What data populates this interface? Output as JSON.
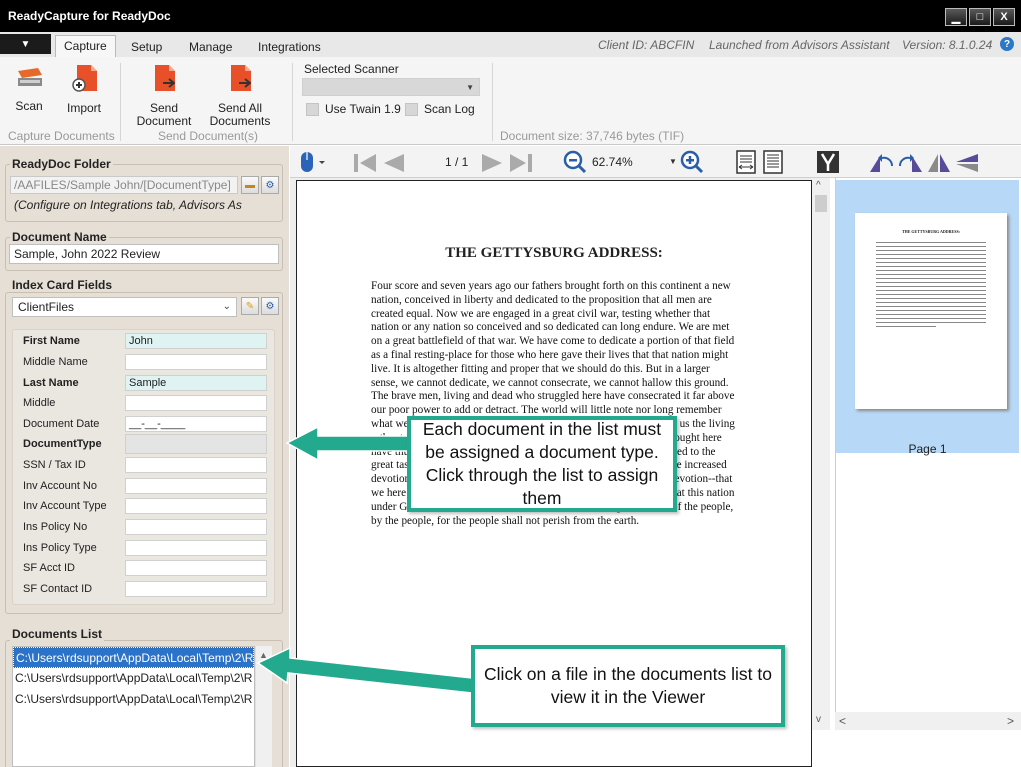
{
  "window": {
    "title": "ReadyCapture for ReadyDoc",
    "minimize": "▁",
    "maximize": "□",
    "close": "X"
  },
  "tabs": [
    "Capture",
    "Setup",
    "Manage",
    "Integrations"
  ],
  "info": {
    "client_id": "Client ID: ABCFIN",
    "launched": "Launched from Advisors Assistant",
    "version": "Version: 8.1.0.24",
    "help": "?"
  },
  "ribbon": {
    "scan": "Scan",
    "import": "Import",
    "send_document": [
      "Send",
      "Document"
    ],
    "send_all": [
      "Send All",
      "Documents"
    ],
    "group_capture": "Capture Documents",
    "group_send": "Send Document(s)",
    "selected_scanner": "Selected Scanner",
    "use_twain": "Use Twain 1.9",
    "scan_log": "Scan Log",
    "doc_size": "Document size: 37,746 bytes (TIF)"
  },
  "folder": {
    "legend": "ReadyDoc Folder",
    "path": "/AAFILES/Sample John/[DocumentType]",
    "note": "(Configure on Integrations tab, Advisors As"
  },
  "docname": {
    "legend": "Document Name",
    "value": "Sample, John 2022 Review"
  },
  "index": {
    "legend": "Index Card Fields",
    "selected": "ClientFiles",
    "fields": [
      {
        "label": "First Name",
        "value": "John"
      },
      {
        "label": "Middle Name",
        "value": ""
      },
      {
        "label": "Last Name",
        "value": "Sample"
      },
      {
        "label": "Middle",
        "value": ""
      },
      {
        "label": "Document Date",
        "value": "__-__-____"
      },
      {
        "label": "DocumentType",
        "value": ""
      },
      {
        "label": "SSN / Tax ID",
        "value": ""
      },
      {
        "label": "Inv Account No",
        "value": ""
      },
      {
        "label": "Inv Account Type",
        "value": ""
      },
      {
        "label": "Ins Policy No",
        "value": ""
      },
      {
        "label": "Ins Policy Type",
        "value": ""
      },
      {
        "label": "SF Acct ID",
        "value": ""
      },
      {
        "label": "SF Contact ID",
        "value": ""
      }
    ]
  },
  "doclist": {
    "legend": "Documents List",
    "items": [
      "C:\\Users\\rdsupport\\AppData\\Local\\Temp\\2\\R",
      "C:\\Users\\rdsupport\\AppData\\Local\\Temp\\2\\R",
      "C:\\Users\\rdsupport\\AppData\\Local\\Temp\\2\\R"
    ]
  },
  "viewer": {
    "page": "1  /  1",
    "zoom": "62.74%"
  },
  "document": {
    "title": "THE GETTYSBURG ADDRESS:",
    "body": "Four score and seven years ago our fathers brought forth on this continent a new nation, conceived in liberty and dedicated to the proposition that all men are created equal. Now we are engaged in a great civil war, testing whether that nation or any nation so conceived and so dedicated can long endure. We are met on a great battlefield of that war. We have come to dedicate a portion of that field as a final resting-place for those who here gave their lives that that nation might live. It is altogether fitting and proper that we should do this. But in a larger sense, we cannot dedicate, we cannot consecrate, we cannot hallow this ground. The brave men, living and dead who struggled here have consecrated it far above our poor power to add or detract. The world will little note nor long remember what we say here, but it can never forget what they did here. It is for us the living rather to be dedicated here to the unfinished work which they who fought here have thus far so nobly advanced. It is rather for us to be here dedicated to the great task remaining before us--that from these honored dead we take increased devotion to that cause for which they gave the last full measure of devotion--that we here highly resolve that these dead shall not have died in vain, that this nation under God shall have a new birth of freedom, and that government of the people, by the people, for the people shall not perish from the earth."
  },
  "thumbnail": {
    "title": "THE GETTYSBURG ADDRESS:",
    "label": "Page 1"
  },
  "callouts": {
    "doctype": "Each document in the list must be assigned a document type. Click through the list to assign them",
    "doclist": "Click on a file in the documents list to view it in the Viewer"
  },
  "colors": {
    "callout_border": "#23a98d",
    "selection": "#2a73c9",
    "thumb_selection": "#b7d9f7"
  }
}
